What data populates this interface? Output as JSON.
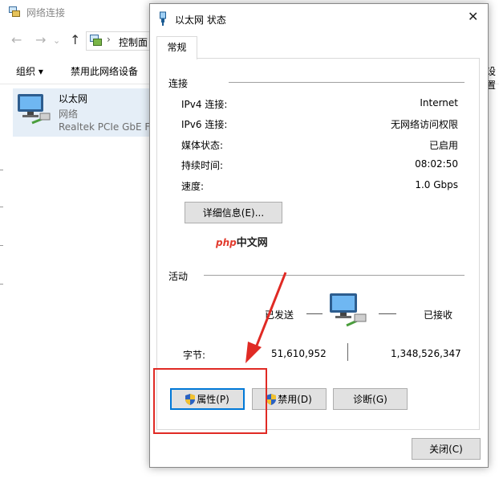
{
  "background": {
    "title": "网络连接",
    "address_segment": "控制面",
    "toolbar": {
      "organize": "组织 ▾",
      "disable_device": "禁用此网络设备",
      "right_partial": "设置"
    },
    "connection": {
      "name": "以太网",
      "status": "网络",
      "adapter": "Realtek PCIe GbE Fa"
    }
  },
  "dialog": {
    "title": "以太网 状态",
    "tab": "常规",
    "connection_group": "连接",
    "rows": [
      {
        "label": "IPv4 连接:",
        "value": "Internet"
      },
      {
        "label": "IPv6 连接:",
        "value": "无网络访问权限"
      },
      {
        "label": "媒体状态:",
        "value": "已启用"
      },
      {
        "label": "持续时间:",
        "value": "08:02:50"
      },
      {
        "label": "速度:",
        "value": "1.0 Gbps"
      }
    ],
    "details_button": "详细信息(E)...",
    "watermark": {
      "part1": "php",
      "part2": "中文网"
    },
    "activity_group": "活动",
    "sent_label": "已发送",
    "received_label": "已接收",
    "bytes_label": "字节:",
    "bytes_sent": "51,610,952",
    "bytes_received": "1,348,526,347",
    "properties_button": "属性(P)",
    "disable_button": "禁用(D)",
    "diagnose_button": "诊断(G)",
    "close_button": "关闭(C)"
  },
  "colors": {
    "annotation": "#e02a24",
    "primary_border": "#0078d7",
    "selection": "#e5eef7"
  }
}
